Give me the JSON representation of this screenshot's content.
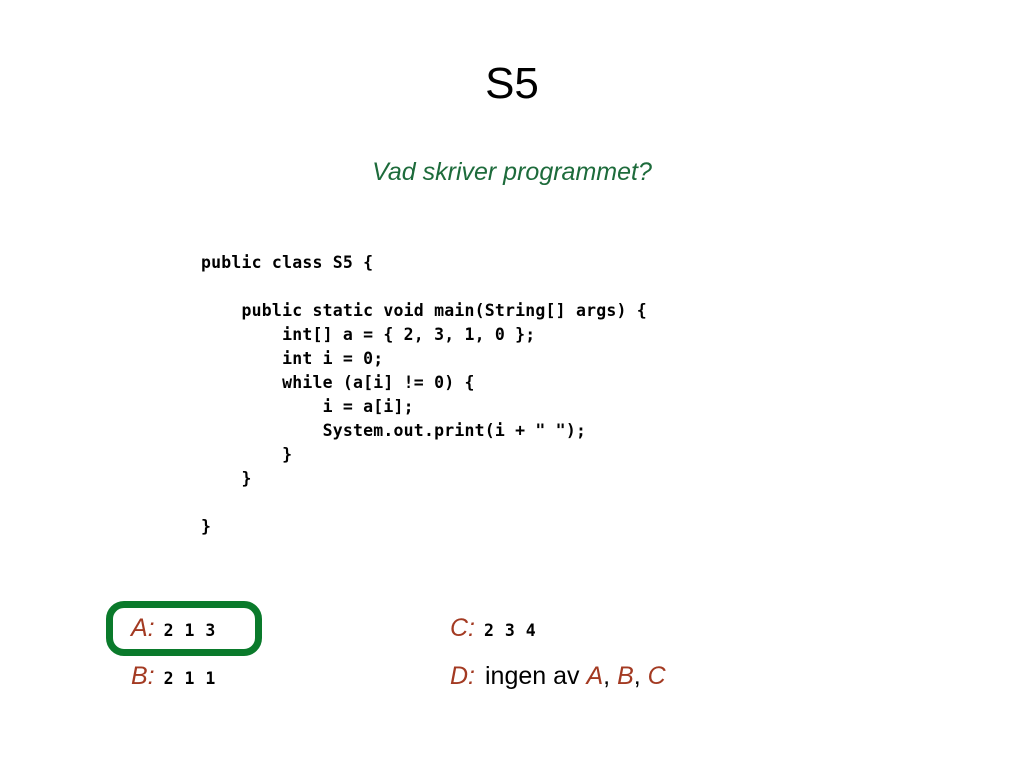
{
  "slide": {
    "title": "S5",
    "subtitle": "Vad skriver programmet?",
    "background_color": "#ffffff",
    "title_color": "#000000",
    "subtitle_color": "#1d6b3b",
    "accent_red": "#a33a22",
    "highlight_green": "#0a7a2b"
  },
  "code": {
    "language": "java",
    "lines": [
      "public class S5 {",
      "",
      "    public static void main(String[] args) {",
      "        int[] a = { 2, 3, 1, 0 };",
      "        int i = 0;",
      "        while (a[i] != 0) {",
      "            i = a[i];",
      "            System.out.print(i + \" \");",
      "        }",
      "    }",
      "",
      "}"
    ]
  },
  "answers": {
    "highlighted": "A",
    "options": [
      {
        "letter": "A:",
        "value": "2 1 3"
      },
      {
        "letter": "B:",
        "value": "2 1 1"
      },
      {
        "letter": "C:",
        "value": "2 3 4"
      },
      {
        "letter": "D:",
        "prefix": "ingen av ",
        "refs": [
          "A",
          "B",
          "C"
        ],
        "separator": ", "
      }
    ]
  }
}
